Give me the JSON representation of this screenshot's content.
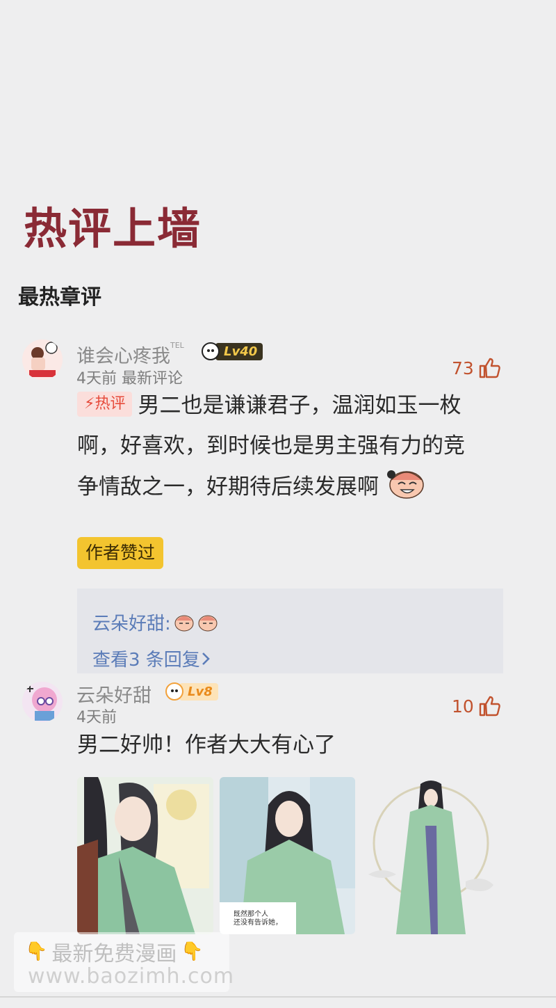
{
  "section_title": "热评上墙",
  "sub_title": "最热章评",
  "comments": [
    {
      "username": "谁会心疼我",
      "username_suffix": "TEL",
      "level": "Lv40",
      "meta": "4天前 最新评论",
      "likes": "73",
      "hot_tag": "热评",
      "lines": [
        "男二也是谦谦君子，温润如玉一枚",
        "啊，好喜欢，到时候也是男主强有力的竞",
        "争情敌之一，好期待后续发展啊"
      ],
      "author_badge": "作者赞过",
      "reply_preview_user": "云朵好甜:",
      "reply_view_more": "查看3 条回复"
    },
    {
      "username": "云朵好甜",
      "level": "Lv8",
      "meta": "4天前",
      "likes": "10",
      "text": "男二好帅！作者大大有心了",
      "image_captions": [
        "既然那个人",
        "还没有告诉她，"
      ]
    }
  ],
  "watermark": {
    "line1": "最新免费漫画",
    "line2": "www.baozimh.com"
  },
  "colors": {
    "title": "#8a2a35",
    "likes": "#c1522e",
    "reply_link": "#5b7cb8",
    "author_badge": "#f3c42f"
  }
}
